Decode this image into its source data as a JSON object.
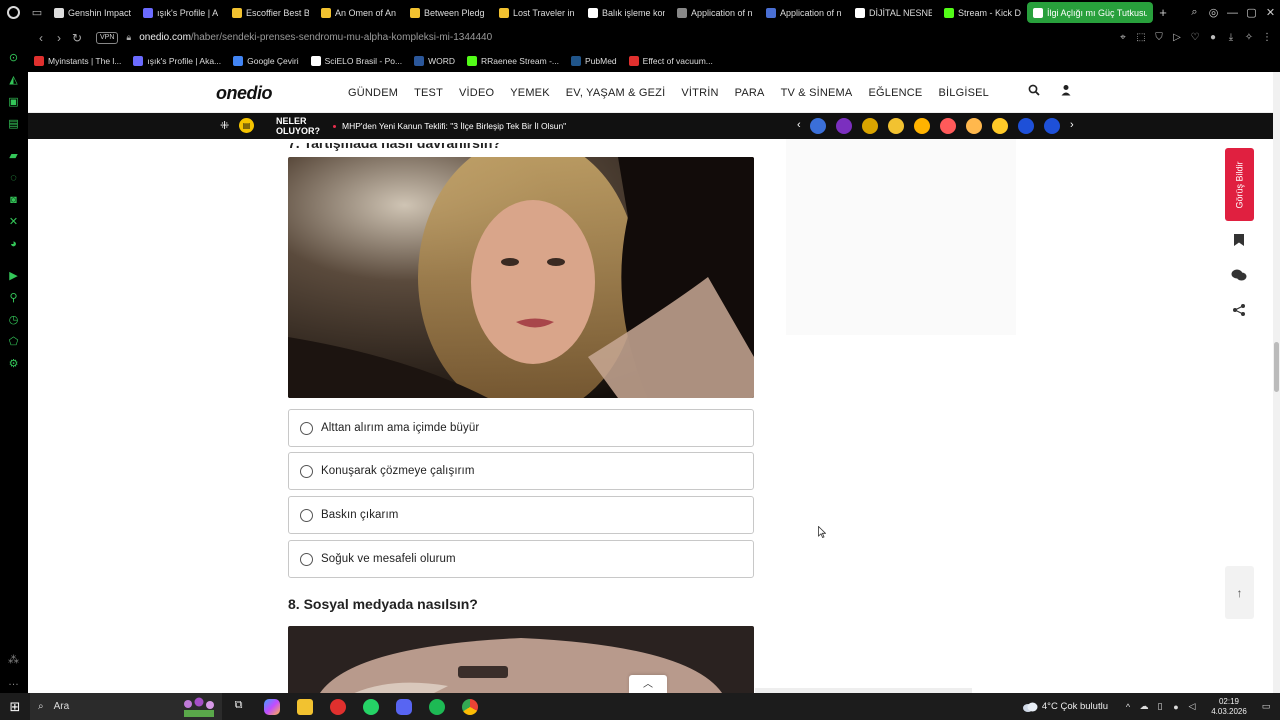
{
  "browser": {
    "tabs": [
      {
        "label": "Genshin Impact",
        "color": "#dddddd"
      },
      {
        "label": "ışık's Profile | A",
        "color": "#6b6bff"
      },
      {
        "label": "Escoffier Best B",
        "color": "#f2c230"
      },
      {
        "label": "An Omen of An",
        "color": "#f2c230"
      },
      {
        "label": "Between Pledg",
        "color": "#f2c230"
      },
      {
        "label": "Lost Traveler in",
        "color": "#f2c230"
      },
      {
        "label": "Balık işleme kon",
        "color": "#ffffff"
      },
      {
        "label": "Application of n",
        "color": "#888888"
      },
      {
        "label": "Application of n",
        "color": "#4a6fd4"
      },
      {
        "label": "DİJİTAL NESNE",
        "color": "#ffffff"
      },
      {
        "label": "Stream - Kick D",
        "color": "#53fc18"
      },
      {
        "label": "İlgi Açlığı mı Güç Tutkusu",
        "color": "#ffffff"
      }
    ],
    "url_domain": "onedio.com",
    "url_path": "/haber/sendeki-prenses-sendromu-mu-alpha-kompleksi-mi-1344440",
    "vpn_label": "VPN",
    "bookmarks": [
      {
        "label": "Myinstants | The l...",
        "color": "#e0302e"
      },
      {
        "label": "ışık's Profile | Aka...",
        "color": "#6b6bff"
      },
      {
        "label": "Google Çeviri",
        "color": "#4285f4"
      },
      {
        "label": "SciELO Brasil - Po...",
        "color": "#ffffff"
      },
      {
        "label": "WORD",
        "color": "#2b579a"
      },
      {
        "label": "RRaenee Stream -...",
        "color": "#53fc18"
      },
      {
        "label": "PubMed",
        "color": "#20558a"
      },
      {
        "label": "Effect of vacuum...",
        "color": "#e0302e"
      }
    ]
  },
  "site": {
    "logo": "onedio",
    "nav": [
      "GÜNDEM",
      "TEST",
      "VİDEO",
      "YEMEK",
      "EV, YAŞAM & GEZİ",
      "VİTRİN",
      "PARA",
      "TV & SİNEMA",
      "EĞLENCE",
      "BİLGİSEL"
    ],
    "news": {
      "title_line1": "NELER",
      "title_line2": "OLUYOR?",
      "headline": "MHP'den Yeni Kanun Teklifi: \"3 İlçe Birleşip Tek Bir İl Olsun\""
    },
    "story_colors": [
      "#3b6fd8",
      "#7b2fbf",
      "#d9a400",
      "#f2c230",
      "#ffb300",
      "#ff5a5a",
      "#ffb84d",
      "#ffca28",
      "#1e50d8",
      "#1e50d8"
    ]
  },
  "quiz": {
    "prev_question": "7. Tartışmada nasıl davranırsın?",
    "options": [
      "Alttan alırım ama içimde büyür",
      "Konuşarak çözmeye çalışırım",
      "Baskın çıkarım",
      "Soğuk ve mesafeli olurum"
    ],
    "next_question": "8. Sosyal medyada nasılsın?"
  },
  "sidebar": {
    "feedback_label": "Görüş Bildir"
  },
  "taskbar": {
    "search_placeholder": "Ara",
    "weather": "4°C  Çok bulutlu",
    "time": "02:19",
    "date": "4.03.2026"
  },
  "colors": {
    "active_tab": "#28a03c",
    "feedback": "#e02040",
    "news_bar": "#111111"
  }
}
